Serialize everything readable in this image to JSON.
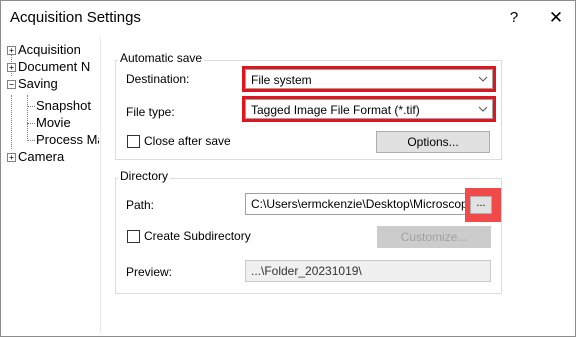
{
  "window": {
    "title": "Acquisition Settings",
    "help_label": "?",
    "close_label": "✕"
  },
  "tree": {
    "items": [
      {
        "label": "Acquisition",
        "expander": "+"
      },
      {
        "label": "Document N",
        "expander": "+"
      },
      {
        "label": "Saving",
        "expander": "−"
      },
      {
        "label": "Snapshot",
        "selected": true
      },
      {
        "label": "Movie"
      },
      {
        "label": "Process Ma"
      },
      {
        "label": "Camera",
        "expander": "+"
      }
    ]
  },
  "automatic_save": {
    "title": "Automatic save",
    "destination_label": "Destination:",
    "destination_value": "File system",
    "file_type_label": "File type:",
    "file_type_value": "Tagged Image File Format (*.tif)",
    "close_after_save_label": "Close after save",
    "close_after_save_checked": false,
    "options_label": "Options..."
  },
  "directory": {
    "title": "Directory",
    "path_label": "Path:",
    "path_value": "C:\\Users\\ermckenzie\\Desktop\\Microscope",
    "browse_label": "...",
    "create_subdirectory_label": "Create Subdirectory",
    "create_subdirectory_checked": false,
    "customize_label": "Customize...",
    "preview_label": "Preview:",
    "preview_value": "...\\Folder_20231019\\"
  },
  "colors": {
    "highlight": "#e0161e",
    "browse_highlight": "#f04a4a"
  }
}
